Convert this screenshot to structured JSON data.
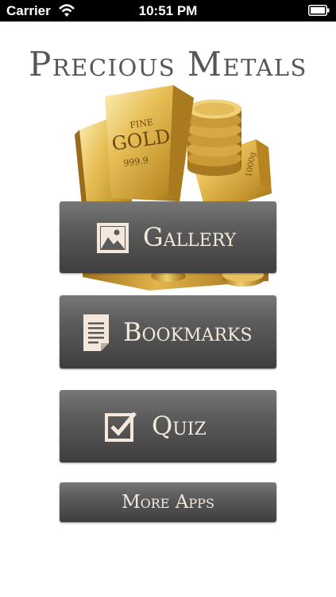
{
  "status_bar": {
    "carrier": "Carrier",
    "time": "10:51 PM"
  },
  "header": {
    "title": "Precious Metals"
  },
  "hero": {
    "bar_stamp_line1": "FINE",
    "bar_stamp_line2": "GOLD",
    "bar_stamp_line3": "999.9",
    "small_bar_stamp": "1000g"
  },
  "menu": {
    "gallery_label": "Gallery",
    "bookmarks_label": "Bookmarks",
    "quiz_label": "Quiz",
    "more_apps_label": "More Apps"
  },
  "colors": {
    "button_text": "#f4e8dd",
    "button_top": "#777777",
    "button_bottom": "#3e3e3e",
    "gold": "#d4a838"
  },
  "icons": {
    "gallery": "picture-icon",
    "bookmarks": "document-icon",
    "quiz": "checkbox-icon"
  }
}
